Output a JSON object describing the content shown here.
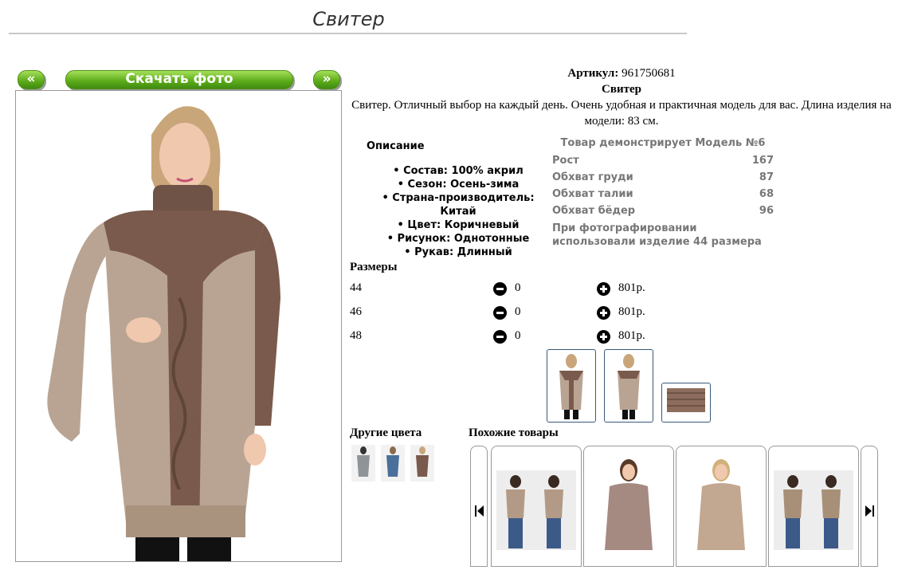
{
  "page": {
    "title": "Свитер"
  },
  "nav": {
    "prev_label": "«",
    "download_label": "Скачать фото",
    "next_label": "»"
  },
  "product": {
    "sku_label": "Артикул:",
    "sku": "961750681",
    "name": "Свитер",
    "description": "Свитер. Отличный выбор на каждый день. Очень удобная и практичная модель для вас. Длина изделия на модели: 83 см."
  },
  "details": {
    "title": "Описание",
    "items": [
      "• Состав: 100% акрил",
      "• Сезон: Осень-зима",
      "• Страна-производитель: Китай",
      "• Цвет: Коричневый",
      "• Рисунок: Однотонные",
      "• Рукав: Длинный"
    ]
  },
  "model": {
    "title": "Товар демонстрирует Модель №6",
    "rows": [
      {
        "label": "Рост",
        "value": "167"
      },
      {
        "label": "Обхват груди",
        "value": "87"
      },
      {
        "label": "Обхват талии",
        "value": "68"
      },
      {
        "label": "Обхват бёдер",
        "value": "96"
      }
    ],
    "note": "При фотографировании использовали изделие 44 размера"
  },
  "sizes": {
    "title": "Размеры",
    "rows": [
      {
        "size": "44",
        "qty": "0",
        "price": "801р."
      },
      {
        "size": "46",
        "qty": "0",
        "price": "801р."
      },
      {
        "size": "48",
        "qty": "0",
        "price": "801р."
      }
    ]
  },
  "other_colors": {
    "title": "Другие цвета"
  },
  "similar": {
    "title": "Похожие товары"
  },
  "colors": {
    "brand_green": "#5fae1c",
    "sweater_brown": "#7a5a4c",
    "sweater_beige": "#b8a38f"
  },
  "icons": [
    "minus-circle-icon",
    "plus-circle-icon",
    "carousel-prev-icon",
    "carousel-next-icon"
  ]
}
